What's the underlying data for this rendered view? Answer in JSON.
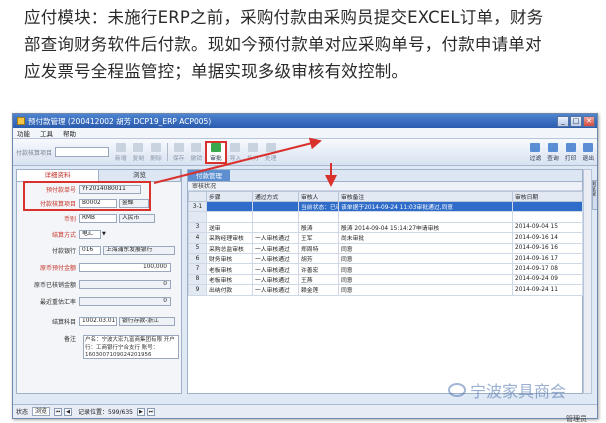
{
  "intro": {
    "line1": "应付模块：未施行ERP之前，采购付款由采购员提交EXCEL订单，财务",
    "line2": "部查询财务软件后付款。现如今预付款单对应采购单号，付款申请单对",
    "line3": "应发票号全程监管控；单据实现多级审核有效控制。"
  },
  "window": {
    "title": "预付款管理 (200412002 胡芳 DCP19_ERP ACP005)",
    "buttons": {
      "minimize": "_",
      "maximize": "□",
      "close": "✕"
    }
  },
  "menu": {
    "items": [
      "功能",
      "工具",
      "帮助"
    ]
  },
  "toolbar": {
    "search_label": "付款核算项目",
    "buttons": [
      "新增",
      "复制",
      "删除",
      "保存",
      "撤销",
      "审批",
      "导入",
      "拆分",
      "处理",
      "过滤",
      "查询",
      "打印",
      "退出"
    ]
  },
  "left_tabs": [
    "详细资料",
    "浏览"
  ],
  "form": {
    "prepay_no": {
      "label": "预付款单号",
      "value": "YF2014080011"
    },
    "item": {
      "label": "付款核算项目",
      "code": "B0002",
      "name": "金蝶"
    },
    "currency": {
      "label": "币别",
      "code": "RMB",
      "name": "人民币"
    },
    "settle": {
      "label": "结算方式",
      "value": "电汇"
    },
    "bank": {
      "label": "付款银行",
      "code": "016",
      "name": "上海浦东发展银行"
    },
    "orig_amount": {
      "label": "原币预付金额",
      "value": "100,000"
    },
    "orig_written": {
      "label": "原币已核销金额",
      "value": "0"
    },
    "rate": {
      "label": "最近重估汇率",
      "value": "0"
    },
    "account": {
      "label": "结算科目",
      "code": "1002.03.01",
      "name": "银行存款-浙江"
    },
    "remark": {
      "label": "备注",
      "value": "户名：宁波大宏九富商集团有限 开户行：工商银行宁合支行 账号：1603007109024201956"
    }
  },
  "grid": {
    "tab": "付款管理",
    "subtitle": "审核状况",
    "headers": [
      "步骤",
      "通过方式",
      "审核人",
      "审核备注",
      "审核日期"
    ],
    "rows": [
      {
        "n": "3-1",
        "step": "",
        "method": "",
        "reviewer": "当前状态：已审核",
        "note": "该单据于2014-09-24 11:03审批通过,同意",
        "date": "",
        "selected": true
      },
      {
        "n": "",
        "step": "",
        "method": "",
        "reviewer": "",
        "note": "",
        "date": ""
      },
      {
        "n": "3",
        "step": "送审",
        "method": "",
        "reviewer": "殷涛",
        "note": "殷涛 2014-09-04 15:14:27申请审核",
        "date": "2014-09-04 15"
      },
      {
        "n": "4",
        "step": "采购经理审核",
        "method": "一人审核通过",
        "reviewer": "王军",
        "note": "尚未审批",
        "date": "2014-09-16 14"
      },
      {
        "n": "5",
        "step": "采购总监审核",
        "method": "一人审核通过",
        "reviewer": "郑周特",
        "note": "同意",
        "date": "2014-09-16 16"
      },
      {
        "n": "6",
        "step": "财务审核",
        "method": "一人审核通过",
        "reviewer": "胡芳",
        "note": "同意",
        "date": "2014-09-16 17"
      },
      {
        "n": "7",
        "step": "老板审核",
        "method": "一人审核通过",
        "reviewer": "许善宏",
        "note": "同意",
        "date": "2014-09-17 08"
      },
      {
        "n": "8",
        "step": "老板审核",
        "method": "一人审核通过",
        "reviewer": "王燕",
        "note": "同意",
        "date": "2014-09-24 09"
      },
      {
        "n": "9",
        "step": "出纳付款",
        "method": "一人审核通过",
        "reviewer": "赖金莲",
        "note": "同意",
        "date": "2014-09-24 11"
      }
    ]
  },
  "side_tab": "浏览窗",
  "status": {
    "state_label": "状态",
    "state": "浏览",
    "record": "记录位置：599/635"
  },
  "watermark": "宁波家具商会",
  "footer": "管理员"
}
